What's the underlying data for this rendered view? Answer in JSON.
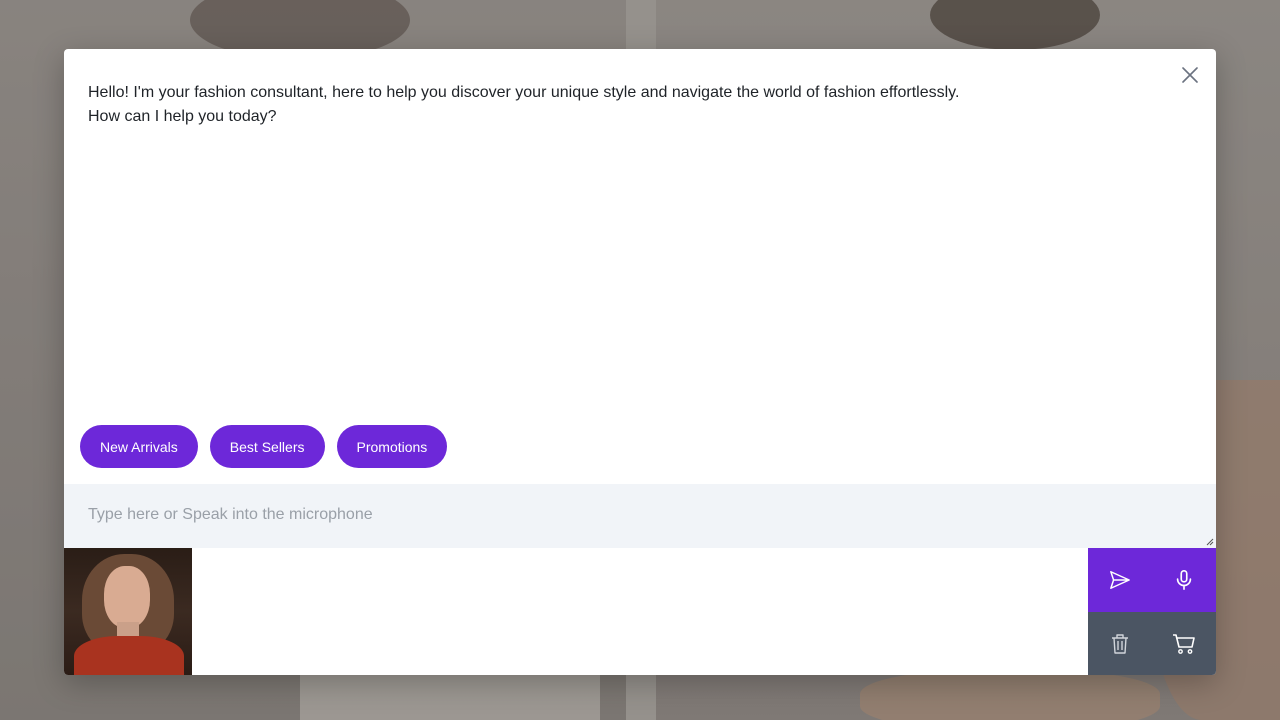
{
  "chat": {
    "greeting_line1": "Hello! I'm your fashion consultant, here to help you discover your unique style and navigate the world of fashion effortlessly.",
    "greeting_line2": "How can I help you today?"
  },
  "quick_replies": [
    {
      "label": "New Arrivals"
    },
    {
      "label": "Best Sellers"
    },
    {
      "label": "Promotions"
    }
  ],
  "input": {
    "value": "",
    "placeholder": "Type here or Speak into the microphone"
  },
  "icons": {
    "close": "close-icon",
    "send": "send-icon",
    "microphone": "microphone-icon",
    "trash": "trash-icon",
    "cart": "cart-icon"
  },
  "colors": {
    "accent": "#6d28d9",
    "secondary_action": "#4b5563",
    "input_background": "#f1f4f8"
  }
}
